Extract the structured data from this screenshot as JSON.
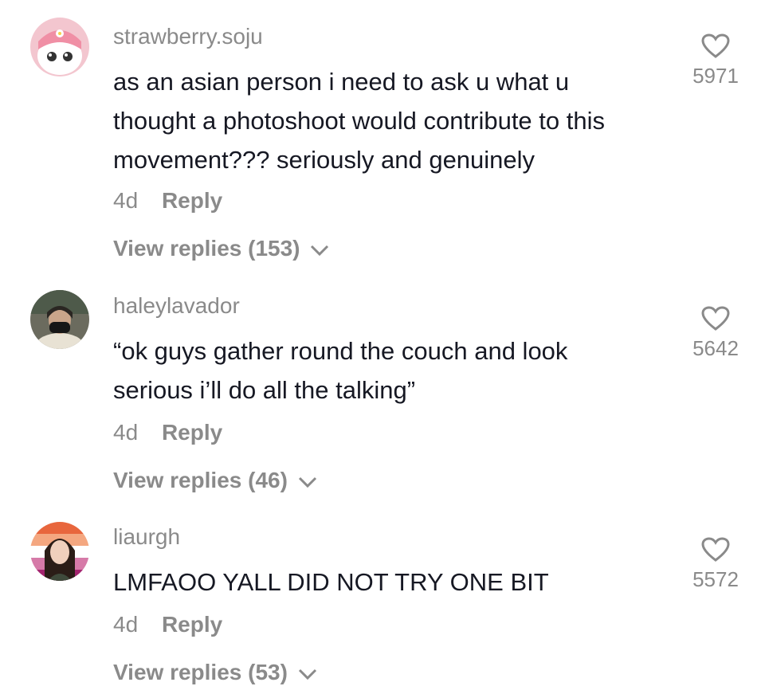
{
  "comments": [
    {
      "username": "strawberry.soju",
      "text": "as an asian person i need to ask u what u\nthought a photoshoot would contribute to this\nmovement??? seriously and genuinely",
      "time": "4d",
      "reply_label": "Reply",
      "view_replies": "View replies (153)",
      "likes": "5971",
      "avatar_icon": "cartoon-character-avatar"
    },
    {
      "username": "haleylavador",
      "text": "“ok guys gather round the couch and look\nserious i’ll do all the talking”",
      "time": "4d",
      "reply_label": "Reply",
      "view_replies": "View replies (46)",
      "likes": "5642",
      "avatar_icon": "person-with-mask-avatar"
    },
    {
      "username": "liaurgh",
      "text": "LMFAOO YALL DID NOT TRY ONE BIT",
      "time": "4d",
      "reply_label": "Reply",
      "view_replies": "View replies (53)",
      "likes": "5572",
      "avatar_icon": "person-portrait-avatar"
    }
  ],
  "colors": {
    "text": "#161823",
    "secondary": "#8a8a8a",
    "background": "#ffffff"
  }
}
